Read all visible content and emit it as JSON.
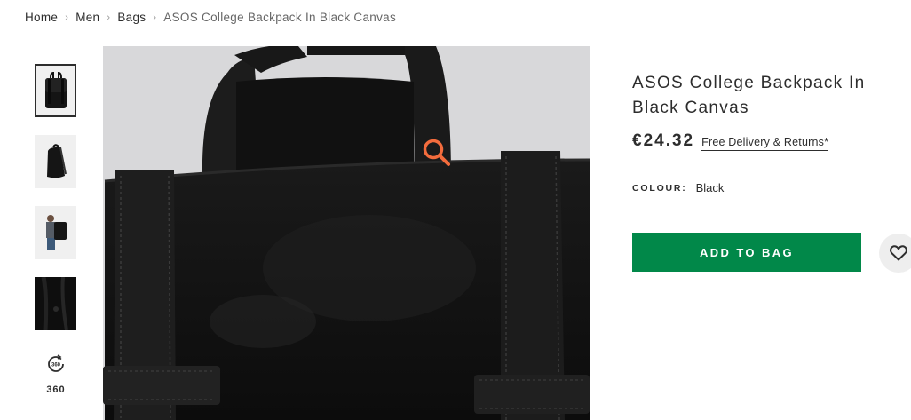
{
  "breadcrumb": {
    "items": [
      "Home",
      "Men",
      "Bags"
    ],
    "current": "ASOS College Backpack In Black Canvas",
    "separator": "›"
  },
  "thumbnails": {
    "items": [
      {
        "name": "backpack-front",
        "active": true
      },
      {
        "name": "backpack-side",
        "active": false
      },
      {
        "name": "backpack-model",
        "active": false
      },
      {
        "name": "backpack-closeup",
        "active": false
      }
    ],
    "spin_label": "360",
    "spin_icon": "rotate-360-icon"
  },
  "main_image": {
    "zoom_icon": "magnifier-icon",
    "zoom_color": "#f36c3d"
  },
  "product": {
    "title": "ASOS College Backpack In Black Canvas",
    "price": "€24.32",
    "delivery_link": "Free Delivery & Returns*",
    "colour_label": "COLOUR:",
    "colour_value": "Black"
  },
  "actions": {
    "add_to_bag_label": "ADD TO BAG",
    "add_to_bag_color": "#018849",
    "save_icon": "heart-icon"
  }
}
